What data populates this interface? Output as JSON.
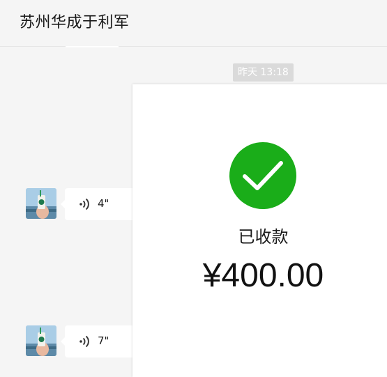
{
  "header": {
    "title": "苏州华成于利军"
  },
  "timestamp": "昨天 13:18",
  "messages": [
    {
      "duration": "4\""
    },
    {
      "duration": "7\""
    }
  ],
  "payment": {
    "status": "已收款",
    "amount": "¥400.00"
  },
  "colors": {
    "accent": "#1aad19",
    "background": "#f5f5f5",
    "bubble": "#ffffff",
    "timestamp_bg": "#dadada"
  },
  "icons": {
    "check": "check-icon",
    "voice": "voice-wave-icon"
  }
}
